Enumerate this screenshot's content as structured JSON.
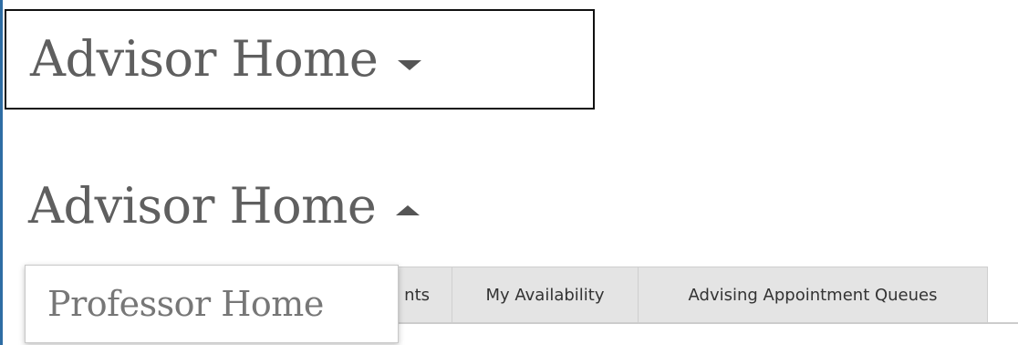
{
  "header_collapsed": {
    "title": "Advisor Home",
    "caret_icon": "caret-down-icon"
  },
  "header_expanded": {
    "title": "Advisor Home",
    "caret_icon": "caret-up-icon"
  },
  "dropdown": {
    "items": [
      {
        "label": "Professor Home"
      }
    ]
  },
  "tabs": [
    {
      "label": "nts"
    },
    {
      "label": "My Availability"
    },
    {
      "label": "Advising Appointment Queues"
    }
  ],
  "colors": {
    "accent_rule": "#2e6da4",
    "heading_text": "#5f5f5f",
    "tab_background": "#e4e4e4"
  }
}
